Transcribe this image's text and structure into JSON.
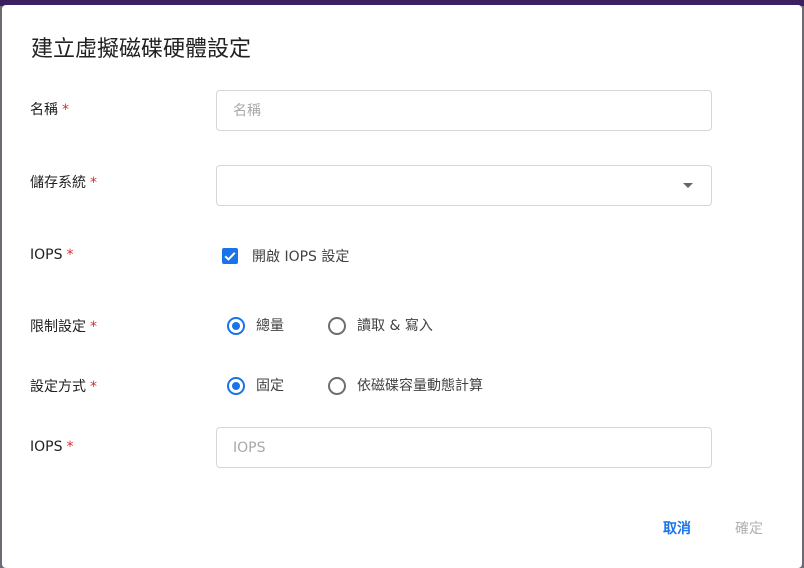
{
  "dialog": {
    "title": "建立虛擬磁碟硬體設定",
    "required_mark": "*",
    "name": {
      "label": "名稱",
      "placeholder": "名稱",
      "value": ""
    },
    "storage": {
      "label": "儲存系統",
      "value": ""
    },
    "iops_toggle": {
      "label": "IOPS",
      "checkbox_label": "開啟 IOPS 設定",
      "checked": true
    },
    "limit": {
      "label": "限制設定",
      "options": [
        "總量",
        "讀取 & 寫入"
      ],
      "selected": "總量"
    },
    "method": {
      "label": "設定方式",
      "options": [
        "固定",
        "依磁碟容量動態計算"
      ],
      "selected": "固定"
    },
    "iops_value": {
      "label": "IOPS",
      "placeholder": "IOPS",
      "value": ""
    },
    "buttons": {
      "cancel": "取消",
      "confirm": "確定"
    }
  },
  "colors": {
    "accent": "#1a73e8",
    "required": "#d32f2f",
    "disabled": "#b0b0b0"
  }
}
